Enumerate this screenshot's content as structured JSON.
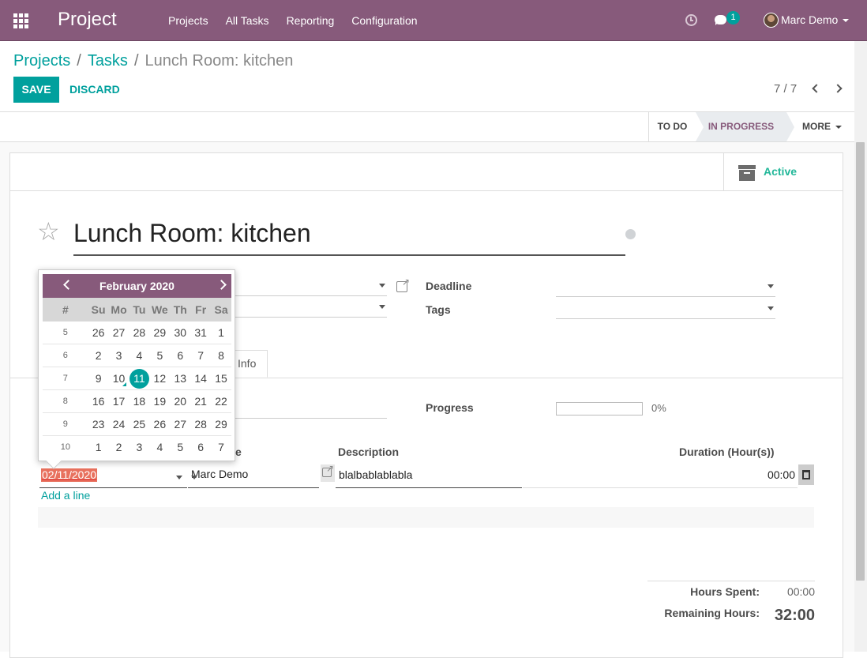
{
  "navbar": {
    "app_title": "Project",
    "menu": [
      "Projects",
      "All Tasks",
      "Reporting",
      "Configuration"
    ],
    "chat_badge": "1",
    "user_name": "Marc Demo"
  },
  "breadcrumb": {
    "projects": "Projects",
    "sep": "/",
    "tasks": "Tasks",
    "current": "Lunch Room: kitchen"
  },
  "buttons": {
    "save": "SAVE",
    "discard": "DISCARD"
  },
  "pager": {
    "value": "7 / 7"
  },
  "stages": {
    "todo": "TO DO",
    "in_progress": "IN PROGRESS",
    "more": "MORE"
  },
  "active_button": {
    "label": "Active"
  },
  "task": {
    "title": "Lunch Room: kitchen"
  },
  "fields": {
    "deadline_label": "Deadline",
    "tags_label": "Tags",
    "progress_label": "Progress",
    "progress_text": "0%",
    "progress_value": 0
  },
  "tab": {
    "label": "Info"
  },
  "timesheet": {
    "col_employee_fragment": "e",
    "col_description": "Description",
    "col_duration": "Duration (Hour(s))",
    "row": {
      "date": "02/11/2020",
      "employee": "Marc Demo",
      "description": "blalbablablabla",
      "duration": "00:00"
    },
    "add_line": "Add a line"
  },
  "totals": {
    "hours_spent_label": "Hours Spent:",
    "hours_spent": "00:00",
    "remaining_label": "Remaining Hours:",
    "remaining": "32:00"
  },
  "datepicker": {
    "title": "February 2020",
    "headers": [
      "#",
      "Su",
      "Mo",
      "Tu",
      "We",
      "Th",
      "Fr",
      "Sa"
    ],
    "weeks": [
      {
        "num": "5",
        "days": [
          "26",
          "27",
          "28",
          "29",
          "30",
          "31",
          "1"
        ]
      },
      {
        "num": "6",
        "days": [
          "2",
          "3",
          "4",
          "5",
          "6",
          "7",
          "8"
        ]
      },
      {
        "num": "7",
        "days": [
          "9",
          "10",
          "11",
          "12",
          "13",
          "14",
          "15"
        ]
      },
      {
        "num": "8",
        "days": [
          "16",
          "17",
          "18",
          "19",
          "20",
          "21",
          "22"
        ]
      },
      {
        "num": "9",
        "days": [
          "23",
          "24",
          "25",
          "26",
          "27",
          "28",
          "29"
        ]
      },
      {
        "num": "10",
        "days": [
          "1",
          "2",
          "3",
          "4",
          "5",
          "6",
          "7"
        ]
      }
    ],
    "selected_day": "11",
    "today_day": "10"
  },
  "colors": {
    "brand": "#875a7b",
    "accent": "#00a09d",
    "active_green": "#21b799"
  }
}
